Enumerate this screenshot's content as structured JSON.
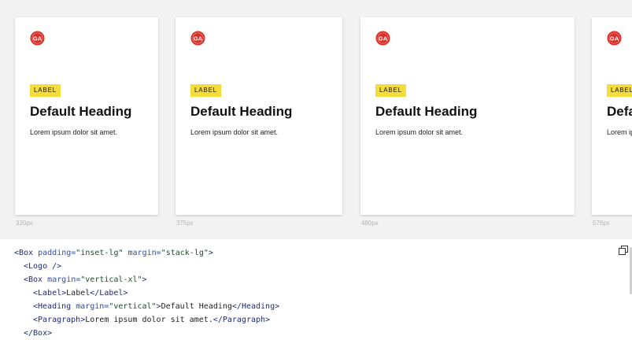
{
  "cards": [
    {
      "logo_text": "GA",
      "label": "LABEL",
      "heading": "Default Heading",
      "paragraph": "Lorem ipsum dolor sit amet.",
      "width_label": "320px"
    },
    {
      "logo_text": "GA",
      "label": "LABEL",
      "heading": "Default Heading",
      "paragraph": "Lorem ipsum dolor sit amet.",
      "width_label": "375px"
    },
    {
      "logo_text": "GA",
      "label": "LABEL",
      "heading": "Default Heading",
      "paragraph": "Lorem ipsum dolor sit amet.",
      "width_label": "480px"
    },
    {
      "logo_text": "GA",
      "label": "LABEL",
      "heading": "Default Heading",
      "paragraph": "Lorem ipsum dolor sit amet.",
      "width_label": "576px"
    }
  ],
  "code": {
    "line1": {
      "tag_open": "<Box ",
      "attr1": "padding=",
      "val1": "\"inset-lg\"",
      "attr2": " margin=",
      "val2": "\"stack-lg\"",
      "tag_close": ">"
    },
    "line2": {
      "tag": "<Logo />"
    },
    "line3": {
      "tag_open": "<Box ",
      "attr1": "margin=",
      "val1": "\"vertical-xl\"",
      "tag_close": ">"
    },
    "line4": {
      "open": "<Label>",
      "text": "Label",
      "close": "</Label>"
    },
    "line5": {
      "tag_open": "<Heading ",
      "attr1": "margin=",
      "val1": "\"vertical\"",
      "tag_close": ">",
      "text": "Default Heading",
      "close": "</Heading>"
    },
    "line6": {
      "open": "<Paragraph>",
      "text": "Lorem ipsum dolor sit amet.",
      "close": "</Paragraph>"
    },
    "line7": {
      "tag": "</Box>"
    }
  },
  "icons": {
    "copy": "copy-icon",
    "logo": "ga-logo-icon"
  },
  "colors": {
    "preview_bg": "#f2f2f2",
    "label_bg": "#f4dc3a",
    "logo_red": "#d9312a",
    "tag": "#1b2a78",
    "value": "#1a4f2a"
  }
}
